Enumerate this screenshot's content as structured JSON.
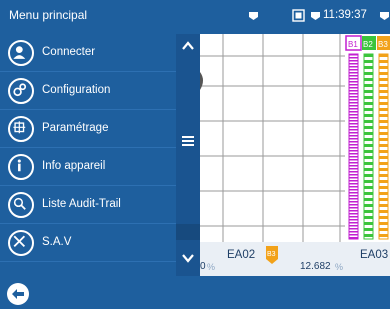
{
  "header": {
    "title": "Menu principal",
    "time": "11:39:37",
    "colors": {
      "bar": "#1e5f9e"
    }
  },
  "menu": {
    "items": [
      {
        "label": "Connecter",
        "icon": "user-icon"
      },
      {
        "label": "Configuration",
        "icon": "gears-icon"
      },
      {
        "label": "Paramétrage",
        "icon": "settings-grid-icon"
      },
      {
        "label": "Info appareil",
        "icon": "info-icon"
      },
      {
        "label": "Liste Audit-Trail",
        "icon": "audit-search-icon"
      },
      {
        "label": "S.A.V",
        "icon": "tools-icon"
      }
    ]
  },
  "chart": {
    "channel_tags": [
      "B1",
      "B2",
      "B3"
    ],
    "channel_colors": [
      "#c21fd1",
      "#3cc43c",
      "#f2a21a"
    ]
  },
  "readout": {
    "channels": [
      {
        "name": "EA02",
        "value": "0",
        "unit": "%"
      },
      {
        "name": "EA03",
        "value": "12.682",
        "unit": "%",
        "badge": "B3"
      }
    ]
  }
}
